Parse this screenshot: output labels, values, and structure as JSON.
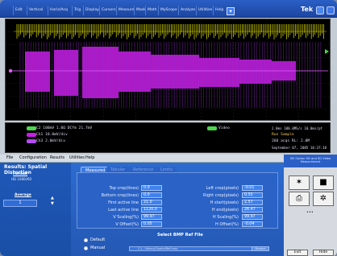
{
  "menu": [
    "Edit",
    "Vertical",
    "Horiz/Acq",
    "Trig",
    "Display",
    "Cursors",
    "Measure",
    "Mask",
    "Math",
    "MyScope",
    "Analyze",
    "Utilities",
    "Help"
  ],
  "help_glyph": "▾",
  "brand": "Tek",
  "readouts": {
    "ch_a": "C2 100mV  1.0Ω DCfm 21.7mV",
    "ch_b": "Ch1 10.0mV/div",
    "ch_c": "Ch3 2.0mV/div",
    "trigger": "Video",
    "timebase": "2.0ms  100.0MS/s  10.0ms/pt",
    "mode": "Run  Sample",
    "acqs": "260 acqs   RL: 2.0M",
    "date": "September 07, 2005  10:37:18"
  },
  "appmenu": [
    "File",
    "Configuration",
    "Results",
    "Utilities",
    "Help"
  ],
  "left": {
    "title": "Results: Spatial Distortion",
    "format_label": "Format",
    "format_value": "HD 1080i/60",
    "average_label": "Average",
    "average_value": "1"
  },
  "tabs": [
    "Measured",
    "Tabular",
    "Reference",
    "Limits"
  ],
  "rows_left": [
    {
      "label": "Top crop(lines)",
      "value": "0.0"
    },
    {
      "label": "Bottom crop(lines)",
      "value": "0.0"
    },
    {
      "label": "First active line",
      "value": "21.0"
    },
    {
      "label": "Last active line",
      "value": "1120.0"
    },
    {
      "label": "V Scaling(%)",
      "value": "99.97"
    },
    {
      "label": "V Offset(%)",
      "value": "0.05"
    }
  ],
  "rows_right": [
    {
      "label": "Left crop(pixels)",
      "value": "-0.01"
    },
    {
      "label": "Right crop(pixels)",
      "value": "0.55"
    },
    {
      "label": "H start(pixels)",
      "value": "2.57"
    },
    {
      "label": "H end(pixels)",
      "value": "26.47"
    },
    {
      "label": "H Scaling(%)",
      "value": "99.97"
    },
    {
      "label": "H Offset(%)",
      "value": "-0.04"
    }
  ],
  "bmp": {
    "title": "Select BMP Ref File",
    "opt_default": "Default",
    "opt_manual": "Manual",
    "path": "C:\\...\\library\\SpatialRef.bmp",
    "browse_label": "Browse"
  },
  "right": {
    "header": "HD Option HD and SD Video Measurement",
    "dots": "•••",
    "exit": "Exit",
    "hide": "Hide"
  },
  "colors": {
    "yellow": "#e8e800",
    "magenta": "#c81ee8",
    "green": "#4fd64f",
    "purple": "#b44df0"
  }
}
